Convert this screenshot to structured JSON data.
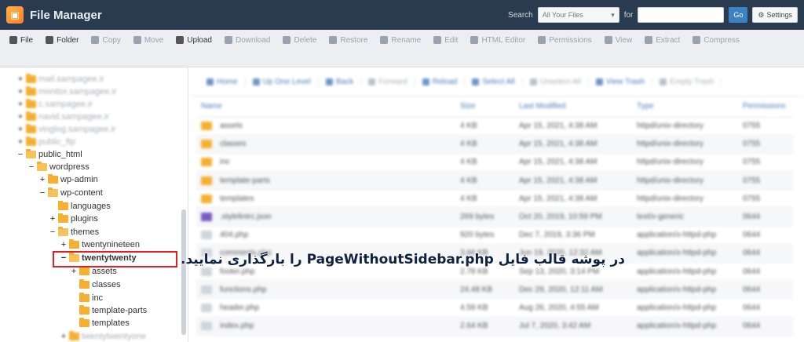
{
  "header": {
    "title": "File Manager",
    "search_label": "Search",
    "search_scope": "All Your Files",
    "for_label": "for",
    "go_label": "Go",
    "settings_label": "Settings"
  },
  "toolbar": [
    {
      "label": "File",
      "icon": "plus-icon",
      "active": true
    },
    {
      "label": "Folder",
      "icon": "plus-icon",
      "active": true
    },
    {
      "label": "Copy",
      "icon": "copy-icon",
      "active": false
    },
    {
      "label": "Move",
      "icon": "move-icon",
      "active": false
    },
    {
      "label": "Upload",
      "icon": "upload-icon",
      "active": true
    },
    {
      "label": "Download",
      "icon": "download-icon",
      "active": false
    },
    {
      "label": "Delete",
      "icon": "delete-icon",
      "active": false
    },
    {
      "label": "Restore",
      "icon": "restore-icon",
      "active": false
    },
    {
      "label": "Rename",
      "icon": "rename-icon",
      "active": false
    },
    {
      "label": "Edit",
      "icon": "edit-icon",
      "active": false
    },
    {
      "label": "HTML Editor",
      "icon": "html-editor-icon",
      "active": false
    },
    {
      "label": "Permissions",
      "icon": "permissions-icon",
      "active": false
    },
    {
      "label": "View",
      "icon": "view-icon",
      "active": false
    },
    {
      "label": "Extract",
      "icon": "extract-icon",
      "active": false
    },
    {
      "label": "Compress",
      "icon": "compress-icon",
      "active": false
    }
  ],
  "tree": {
    "blurred_top": [
      "mail.sampagee.ir",
      "monitor.sampagee.ir",
      "c.sampagee.ir",
      "navid.sampagee.ir",
      "vinglog.sampagee.ir",
      "public_ftp"
    ],
    "public_html": "public_html",
    "wordpress": "wordpress",
    "wp_admin": "wp-admin",
    "wp_content": "wp-content",
    "languages": "languages",
    "plugins": "plugins",
    "themes": "themes",
    "twentynineteen": "twentynineteen",
    "twentytwenty": "twentytwenty",
    "assets": "assets",
    "classes": "classes",
    "inc": "inc",
    "template_parts": "template-parts",
    "templates": "templates",
    "blurred_bottom": "twentytwentyone"
  },
  "navbar": [
    {
      "label": "Home",
      "dim": false
    },
    {
      "label": "Up One Level",
      "dim": false
    },
    {
      "label": "Back",
      "dim": false
    },
    {
      "label": "Forward",
      "dim": true
    },
    {
      "label": "Reload",
      "dim": false
    },
    {
      "label": "Select All",
      "dim": false
    },
    {
      "label": "Unselect All",
      "dim": true
    },
    {
      "label": "View Trash",
      "dim": false
    },
    {
      "label": "Empty Trash",
      "dim": true
    }
  ],
  "table": {
    "headers": [
      "Name",
      "Size",
      "Last Modified",
      "Type",
      "Permissions"
    ],
    "rows": [
      {
        "icon": "dir",
        "name": "assets",
        "size": "4 KB",
        "modified": "Apr 15, 2021, 4:38 AM",
        "type": "httpd/unix-directory",
        "perms": "0755"
      },
      {
        "icon": "dir",
        "name": "classes",
        "size": "4 KB",
        "modified": "Apr 15, 2021, 4:38 AM",
        "type": "httpd/unix-directory",
        "perms": "0755"
      },
      {
        "icon": "dir",
        "name": "inc",
        "size": "4 KB",
        "modified": "Apr 15, 2021, 4:38 AM",
        "type": "httpd/unix-directory",
        "perms": "0755"
      },
      {
        "icon": "dir",
        "name": "template-parts",
        "size": "4 KB",
        "modified": "Apr 15, 2021, 4:38 AM",
        "type": "httpd/unix-directory",
        "perms": "0755"
      },
      {
        "icon": "dir",
        "name": "templates",
        "size": "4 KB",
        "modified": "Apr 15, 2021, 4:38 AM",
        "type": "httpd/unix-directory",
        "perms": "0755"
      },
      {
        "icon": "json",
        "name": ".stylelintrc.json",
        "size": "269 bytes",
        "modified": "Oct 20, 2019, 10:59 PM",
        "type": "text/x-generic",
        "perms": "0644"
      },
      {
        "icon": "php",
        "name": "404.php",
        "size": "920 bytes",
        "modified": "Dec 7, 2019, 3:36 PM",
        "type": "application/x-httpd-php",
        "perms": "0644"
      },
      {
        "icon": "php",
        "name": "comments.php",
        "size": "3.66 KB",
        "modified": "Jun 19, 2020, 12:32 AM",
        "type": "application/x-httpd-php",
        "perms": "0644"
      },
      {
        "icon": "php",
        "name": "footer.php",
        "size": "2.78 KB",
        "modified": "Sep 13, 2020, 3:14 PM",
        "type": "application/x-httpd-php",
        "perms": "0644"
      },
      {
        "icon": "php",
        "name": "functions.php",
        "size": "24.48 KB",
        "modified": "Dec 29, 2020, 12:11 AM",
        "type": "application/x-httpd-php",
        "perms": "0644"
      },
      {
        "icon": "php",
        "name": "header.php",
        "size": "4.59 KB",
        "modified": "Aug 26, 2020, 4:55 AM",
        "type": "application/x-httpd-php",
        "perms": "0644"
      },
      {
        "icon": "php",
        "name": "index.php",
        "size": "2.64 KB",
        "modified": "Jul 7, 2020, 3:42 AM",
        "type": "application/x-httpd-php",
        "perms": "0644"
      }
    ]
  },
  "annotation": "در پوشه قالب فایل PageWithoutSidebar.php را بارگذاری نمایید.",
  "colors": {
    "topbar": "#2a3b4f",
    "folder": "#f5b031",
    "highlight": "#e02020",
    "link": "#4a7bb7"
  }
}
